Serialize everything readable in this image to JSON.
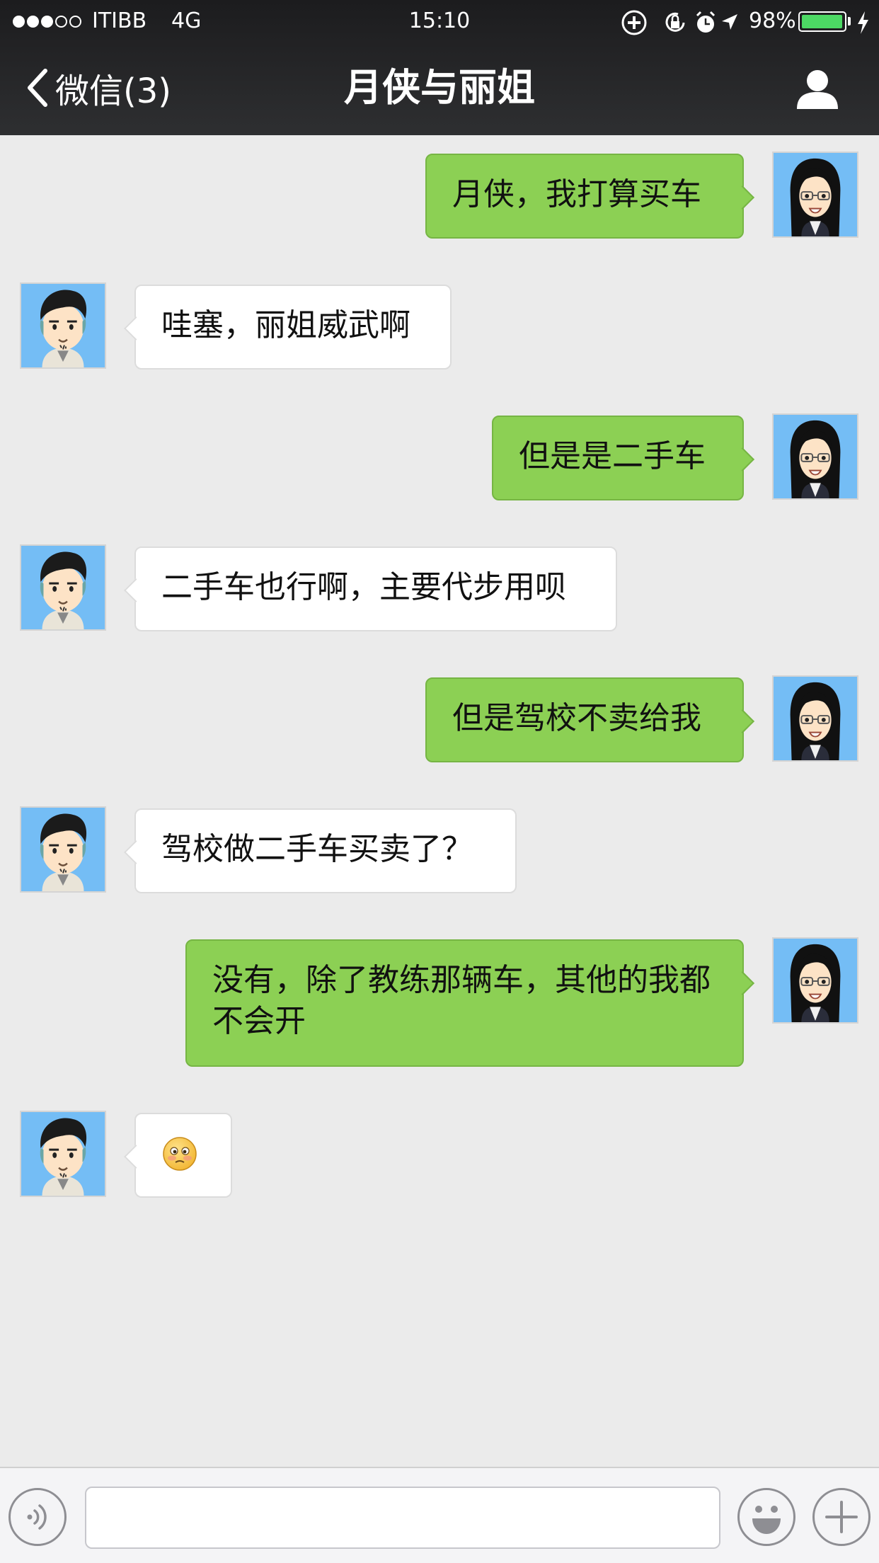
{
  "status_bar": {
    "carrier": "ITIBB",
    "network": "4G",
    "time": "15:10",
    "battery": "98%",
    "battery_level": 0.98
  },
  "nav": {
    "back_label": "微信(3)",
    "title": "月侠与丽姐"
  },
  "messages": [
    {
      "sender": "丽姐",
      "direction": "out",
      "text": "月侠，我打算买车"
    },
    {
      "sender": "月侠",
      "direction": "in",
      "text": "哇塞，丽姐威武啊"
    },
    {
      "sender": "丽姐",
      "direction": "out",
      "text": "但是是二手车"
    },
    {
      "sender": "月侠",
      "direction": "in",
      "text": "二手车也行啊，主要代步用呗"
    },
    {
      "sender": "丽姐",
      "direction": "out",
      "text": "但是驾校不卖给我"
    },
    {
      "sender": "月侠",
      "direction": "in",
      "text": "驾校做二手车买卖了？"
    },
    {
      "sender": "丽姐",
      "direction": "out",
      "text": "没有，除了教练那辆车，其他的我都不会开"
    },
    {
      "sender": "月侠",
      "direction": "in",
      "text": "",
      "emoji": "embarrassed-face"
    }
  ],
  "input": {
    "value": "",
    "placeholder": ""
  },
  "colors": {
    "outgoing_bubble": "#8cd054",
    "incoming_bubble": "#ffffff",
    "chat_background": "#ebebeb",
    "nav_background": "#2a2b2d",
    "avatar_background": "#74bdf5"
  }
}
